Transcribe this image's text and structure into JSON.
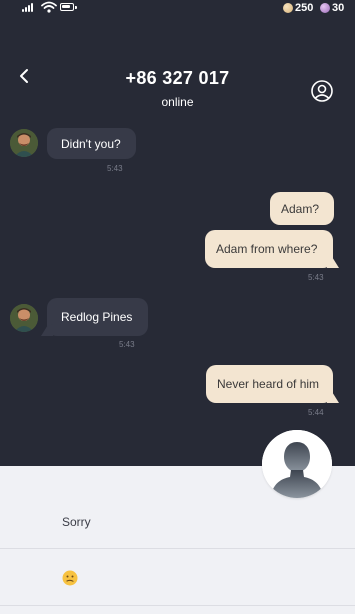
{
  "status_bar": {
    "signal_icon": "signal-bars-icon",
    "wifi_icon": "wifi-icon",
    "battery_icon": "battery-icon",
    "coins": "250",
    "gems": "30"
  },
  "header": {
    "title": "+86 327 017",
    "subtitle": "online",
    "back_icon": "chevron-left-icon",
    "profile_icon": "user-circle-icon"
  },
  "messages": [
    {
      "side": "in",
      "text": "Didn't you?",
      "time": "5:43",
      "avatar": "contact-avatar"
    },
    {
      "side": "out",
      "text": "Adam?"
    },
    {
      "side": "out",
      "text": "Adam from where?",
      "time": "5:43"
    },
    {
      "side": "in",
      "text": "Redlog Pines",
      "time": "5:43",
      "avatar": "contact-avatar"
    },
    {
      "side": "out",
      "text": "Never heard of him",
      "time": "5:44"
    }
  ],
  "replies": [
    {
      "text": "Sorry"
    },
    {
      "emoji": "confused-face-emoji"
    }
  ],
  "colors": {
    "background": "#272a36",
    "incoming_bubble": "#373a48",
    "outgoing_bubble": "#f3e5d1",
    "reply_panel": "#f0f1f5"
  }
}
